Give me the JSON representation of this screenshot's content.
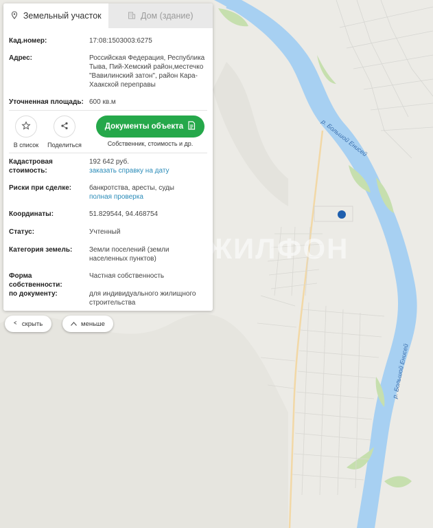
{
  "tabs": [
    {
      "label": "Земельный участок",
      "icon": "location-pin-icon",
      "active": true
    },
    {
      "label": "Дом (здание)",
      "icon": "building-icon",
      "active": false
    }
  ],
  "info": {
    "cadastral_label": "Кад.номер:",
    "cadastral_value": "17:08:1503003:6275",
    "address_label": "Адрес:",
    "address_lines": [
      "Российская Федерация, Республика",
      "Тыва, Пий-Хемский район,местечко",
      "\"Вавилинский затон\", район Кара-",
      "Хаакской переправы"
    ],
    "area_label": "Уточненная площадь:",
    "area_value": "600 кв.м"
  },
  "actions": {
    "add_to_list": "В список",
    "share": "Поделиться",
    "documents_button": "Документы объекта",
    "documents_sub": "Собственник, стоимость и др."
  },
  "details": {
    "cost_label_1": "Кадастровая",
    "cost_label_2": "стоимость:",
    "cost_value": "192 642 руб.",
    "cost_link": "заказать справку на дату",
    "risks_label": "Риски при сделке:",
    "risks_value": "банкротства, аресты, суды",
    "risks_link": "полная проверка",
    "coords_label": "Координаты:",
    "coords_value": "51.829544, 94.468754",
    "status_label": "Статус:",
    "status_value": "Учтенный",
    "category_label": "Категория земель:",
    "category_lines": [
      "Земли поселений (земли",
      "населенных пунктов)"
    ],
    "ownership_label": "Форма собственности:",
    "ownership_value": "Частная собственность",
    "document_label": "по документу:",
    "document_lines": [
      "для индивидуального жилищного",
      "строительства"
    ]
  },
  "controls": {
    "hide": "скрыть",
    "less": "меньше"
  },
  "map": {
    "river_label_upper": "р. Большой Енисей",
    "river_label_lower": "р. Большой Енисей",
    "watermark": "ЖИЛФОН",
    "water_color": "#a7d0f2",
    "marker_color": "#1f5fae"
  },
  "colors": {
    "accent_green": "#25a84a",
    "link_blue": "#2a8bb8"
  }
}
